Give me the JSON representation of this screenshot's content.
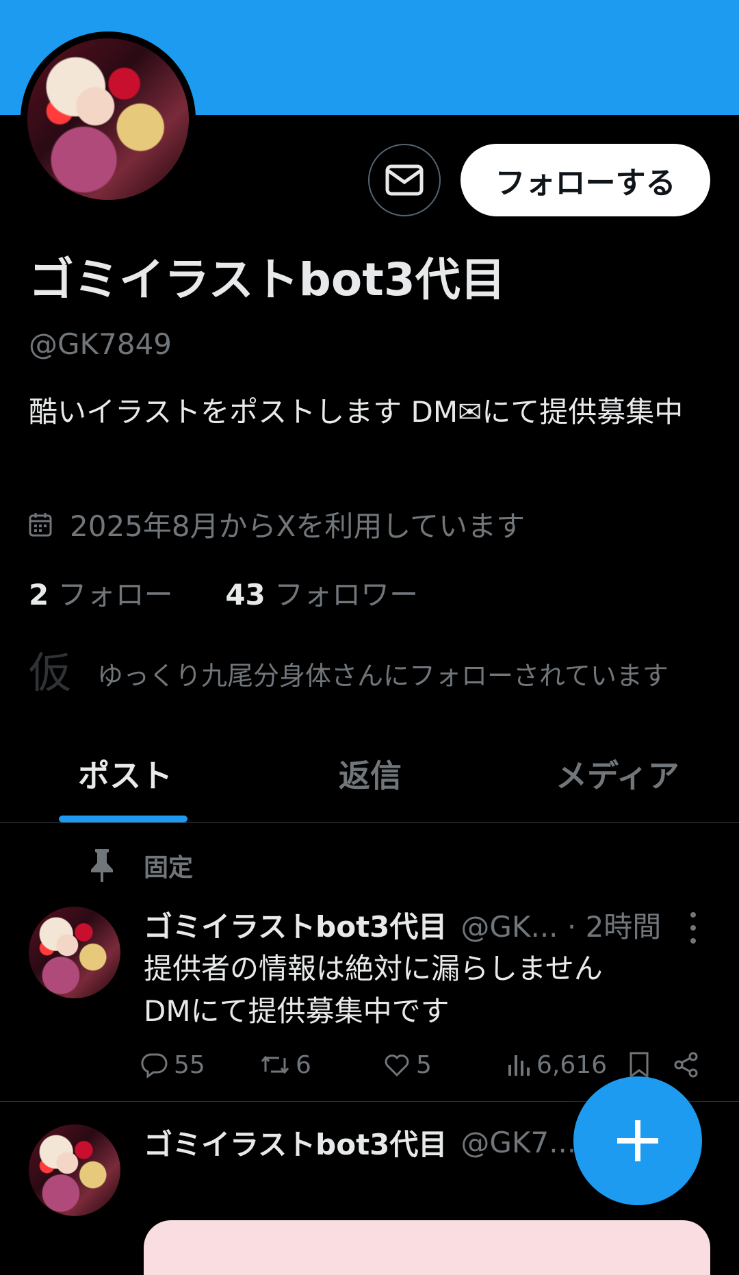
{
  "profile": {
    "display_name": "ゴミイラストbot3代目",
    "handle": "@GK7849",
    "bio": "酷いイラストをポストします DM✉にて提供募集中",
    "joined": "2025年8月からXを利用しています",
    "following_count": "2",
    "following_label": "フォロー",
    "followers_count": "43",
    "followers_label": "フォロワー",
    "followed_by_icon_text": "仮",
    "followed_by": "ゆっくり九尾分身体さんにフォローされています",
    "follow_button": "フォローする"
  },
  "tabs": [
    "ポスト",
    "返信",
    "メディア"
  ],
  "pinned_label": "固定",
  "posts": [
    {
      "name": "ゴミイラストbot3代目",
      "handle_meta": "@GK... · 2時間",
      "text": "提供者の情報は絶対に漏らしません\nDMにて提供募集中です",
      "replies": "55",
      "reposts": "6",
      "likes": "5",
      "views": "6,616"
    },
    {
      "name": "ゴミイラストbot3代目",
      "handle_meta": "@GK7..."
    }
  ],
  "colors": {
    "accent": "#1d9bf0",
    "background": "#000000",
    "secondary_text": "#71767b"
  },
  "icons": [
    "mail-icon",
    "calendar-icon",
    "pin-icon",
    "reply-icon",
    "repost-icon",
    "like-icon",
    "views-icon",
    "bookmark-icon",
    "share-icon",
    "more-icon",
    "plus-icon"
  ]
}
